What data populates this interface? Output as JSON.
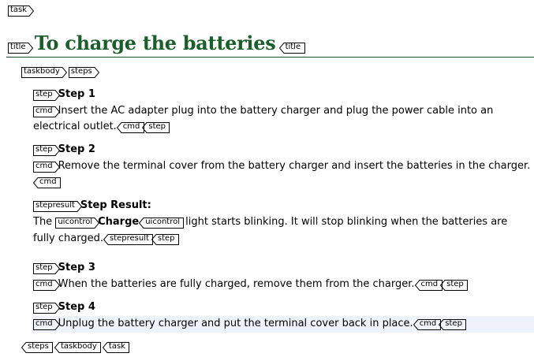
{
  "tags": {
    "task": "task",
    "title": "title",
    "taskbody": "taskbody",
    "steps": "steps",
    "step": "step",
    "cmd": "cmd",
    "stepresult": "stepresult",
    "uicontrol": "uicontrol"
  },
  "title": "To charge the batteries",
  "steps": [
    {
      "label": "Step 1",
      "cmd_line1": "Insert the AC adapter plug into the battery charger and plug the power cable into an",
      "cmd_line2": "electrical outlet."
    },
    {
      "label": "Step 2",
      "cmd_line1": "Remove the terminal cover from the battery charger and insert the batteries in the charger.",
      "result_label": "Step Result:",
      "result_pre": "The",
      "result_uicontrol": "Charge",
      "result_post": "light starts blinking. It will stop blinking when the batteries are",
      "result_line2": "fully charged."
    },
    {
      "label": "Step 3",
      "cmd_line1": "When the batteries are fully charged, remove them from the charger."
    },
    {
      "label": "Step 4",
      "cmd_line1": "Unplug the battery charger and put the terminal cover back in place."
    }
  ]
}
